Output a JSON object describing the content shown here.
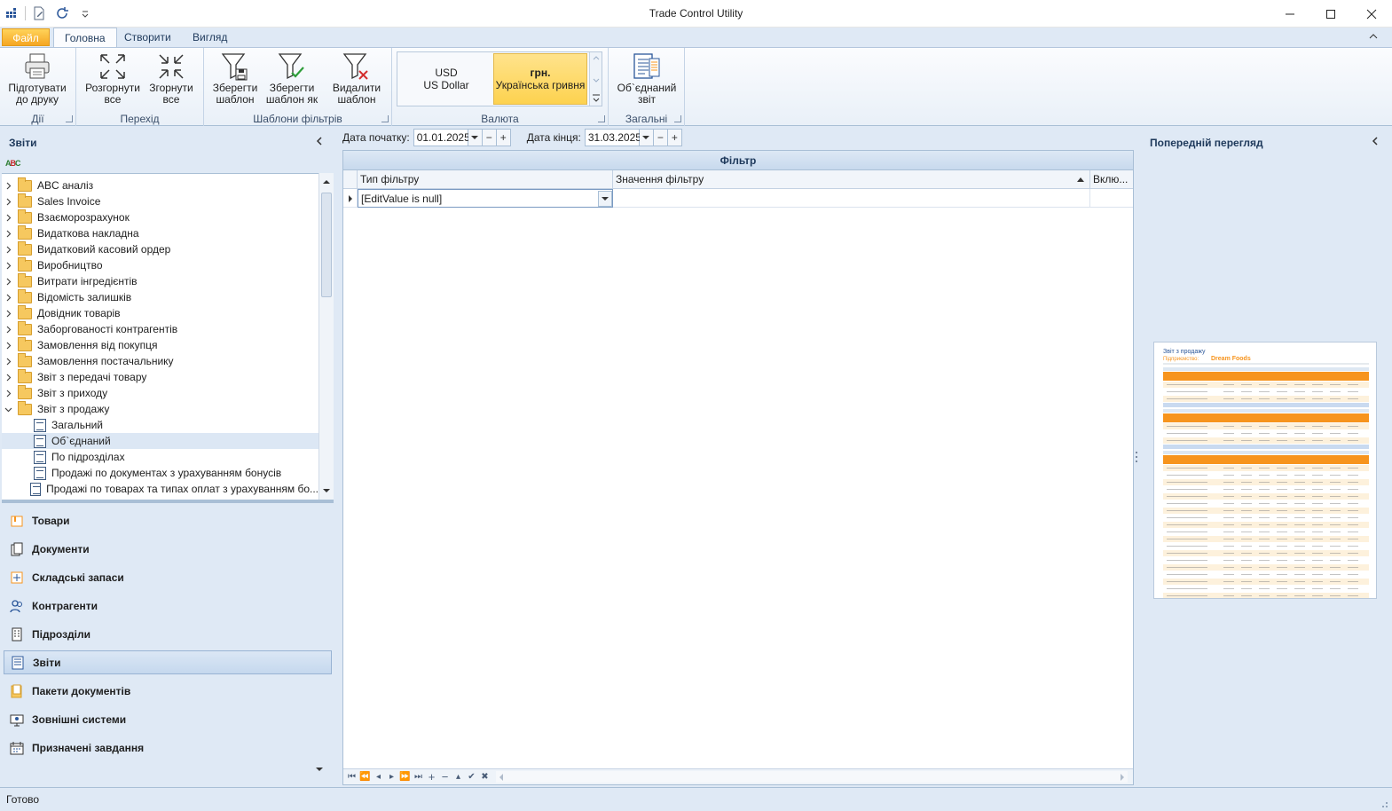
{
  "window": {
    "title": "Trade Control Utility"
  },
  "tabs": {
    "file": "Файл",
    "home": "Головна",
    "create": "Створити",
    "view": "Вигляд"
  },
  "ribbon": {
    "actions": {
      "print_l1": "Підготувати",
      "print_l2": "до друку",
      "caption": "Дії"
    },
    "navigation": {
      "expand_l1": "Розгорнути",
      "expand_l2": "все",
      "collapse_l1": "Згорнути",
      "collapse_l2": "все",
      "caption": "Перехід"
    },
    "filters": {
      "save_l1": "Зберегти",
      "save_l2": "шаблон",
      "saveas_l1": "Зберегти",
      "saveas_l2": "шаблон як",
      "delete_l1": "Видалити",
      "delete_l2": "шаблон",
      "caption": "Шаблони фільтрів"
    },
    "currency": {
      "usd_code": "USD",
      "usd_name": "US Dollar",
      "uah_code": "грн.",
      "uah_name": "Українська гривня",
      "caption": "Валюта"
    },
    "general": {
      "combined_l1": "Об`єднаний",
      "combined_l2": "звіт",
      "caption": "Загальні"
    }
  },
  "left_panel": {
    "title": "Звіти",
    "tree": [
      {
        "label": "ABC аналіз",
        "type": "folder",
        "expanded": false
      },
      {
        "label": "Sales Invoice",
        "type": "folder",
        "expanded": false
      },
      {
        "label": "Взаєморозрахунок",
        "type": "folder",
        "expanded": false
      },
      {
        "label": "Видаткова накладна",
        "type": "folder",
        "expanded": false
      },
      {
        "label": "Видатковий касовий ордер",
        "type": "folder",
        "expanded": false
      },
      {
        "label": "Виробництво",
        "type": "folder",
        "expanded": false
      },
      {
        "label": "Витрати інгредієнтів",
        "type": "folder",
        "expanded": false
      },
      {
        "label": "Відомість залишків",
        "type": "folder",
        "expanded": false
      },
      {
        "label": "Довідник товарів",
        "type": "folder",
        "expanded": false
      },
      {
        "label": "Заборгованості контрагентів",
        "type": "folder",
        "expanded": false
      },
      {
        "label": "Замовлення від покупця",
        "type": "folder",
        "expanded": false
      },
      {
        "label": "Замовлення постачальнику",
        "type": "folder",
        "expanded": false
      },
      {
        "label": "Звіт з передачі товару",
        "type": "folder",
        "expanded": false
      },
      {
        "label": "Звіт з приходу",
        "type": "folder",
        "expanded": false
      },
      {
        "label": "Звіт з продажу",
        "type": "folder",
        "expanded": true
      },
      {
        "label": "Загальний",
        "type": "report"
      },
      {
        "label": "Об`єднаний",
        "type": "report",
        "selected": true
      },
      {
        "label": "По підрозділах",
        "type": "report"
      },
      {
        "label": "Продажі по документах з урахуванням бонусів",
        "type": "report"
      },
      {
        "label": "Продажі по товарах та типах оплат з урахуванням бо...",
        "type": "report"
      }
    ],
    "nav": [
      {
        "label": "Товари",
        "icon": "goods-icon"
      },
      {
        "label": "Документи",
        "icon": "documents-icon"
      },
      {
        "label": "Складські запаси",
        "icon": "stock-icon"
      },
      {
        "label": "Контрагенти",
        "icon": "contractors-icon"
      },
      {
        "label": "Підрозділи",
        "icon": "divisions-icon"
      },
      {
        "label": "Звіти",
        "icon": "reports-icon",
        "active": true
      },
      {
        "label": "Пакети документів",
        "icon": "document-packages-icon"
      },
      {
        "label": "Зовнішні системи",
        "icon": "external-systems-icon"
      },
      {
        "label": "Призначені завдання",
        "icon": "scheduled-tasks-icon"
      }
    ]
  },
  "filter": {
    "start_label": "Дата початку:",
    "start_value": "01.01.2025",
    "end_label": "Дата кінця:",
    "end_value": "31.03.2025",
    "band": "Фільтр",
    "columns": {
      "type": "Тип фільтру",
      "value": "Значення фільтру",
      "include": "Вклю..."
    },
    "row": {
      "type": "[EditValue is null]",
      "value": "",
      "include": ""
    }
  },
  "preview": {
    "title": "Попередній перегляд",
    "doc_title": "Звіт з продажу",
    "company_label": "Підприємство:",
    "company": "Dream Foods"
  },
  "status": {
    "text": "Готово"
  },
  "colors": {
    "accent": "#f7941d",
    "selected": "#fdd24f",
    "ribbon": "#dfe9f5"
  }
}
